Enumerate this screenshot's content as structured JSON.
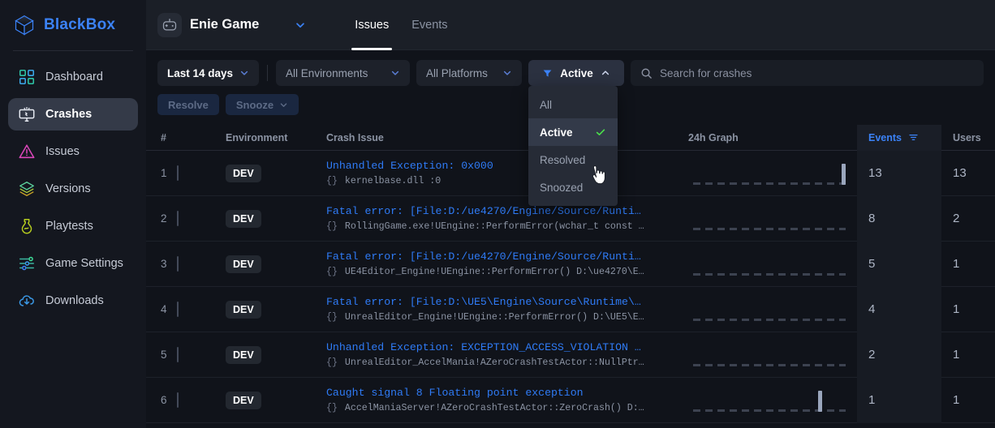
{
  "brand": {
    "name": "BlackBox",
    "logo_icon": "cube-logo-icon"
  },
  "sidebar": {
    "items": [
      {
        "label": "Dashboard",
        "icon": "dashboard-grid-icon",
        "active": false
      },
      {
        "label": "Crashes",
        "icon": "crash-monitor-icon",
        "active": true
      },
      {
        "label": "Issues",
        "icon": "warning-triangle-icon",
        "active": false
      },
      {
        "label": "Versions",
        "icon": "layers-stack-icon",
        "active": false
      },
      {
        "label": "Playtests",
        "icon": "flask-potion-icon",
        "active": false
      },
      {
        "label": "Game Settings",
        "icon": "sliders-icon",
        "active": false
      },
      {
        "label": "Downloads",
        "icon": "cloud-download-icon",
        "active": false
      }
    ]
  },
  "topbar": {
    "game_name": "Enie Game",
    "game_icon": "gamepad-robot-icon",
    "game_switch_icon": "chevron-down-icon",
    "tabs": [
      {
        "label": "Issues",
        "active": true
      },
      {
        "label": "Events",
        "active": false
      }
    ]
  },
  "filters": {
    "date_range": "Last 14 days",
    "environment": "All Environments",
    "platform": "All Platforms",
    "status": "Active",
    "status_filter_icon": "funnel-icon",
    "status_caret_icon": "chevron-up-icon",
    "status_open": true,
    "status_options": [
      {
        "label": "All",
        "selected": false
      },
      {
        "label": "Active",
        "selected": true
      },
      {
        "label": "Resolved",
        "selected": false
      },
      {
        "label": "Snoozed",
        "selected": false
      }
    ],
    "check_icon": "check-icon",
    "cursor_icon": "pointer-hand-cursor-icon"
  },
  "search": {
    "placeholder": "Search for crashes",
    "icon": "search-icon"
  },
  "actions": {
    "resolve": "Resolve",
    "snooze": "Snooze",
    "snooze_caret_icon": "chevron-down-icon"
  },
  "table": {
    "columns": {
      "index": "#",
      "environment": "Environment",
      "issue": "Crash Issue",
      "graph": "24h Graph",
      "events": "Events",
      "users": "Users"
    },
    "events_sort_icon": "sort-filter-icon",
    "rows": [
      {
        "index": "1",
        "environment": "DEV",
        "title": "Unhandled Exception: 0x000",
        "subtitle": "kernelbase.dll :0",
        "events": "13",
        "users": "13",
        "bars": [
          {
            "x": 91,
            "h": 26
          }
        ]
      },
      {
        "index": "2",
        "environment": "DEV",
        "title": "Fatal error: [File:D:/ue4270/Engine/Source/Runti…",
        "subtitle": "RollingGame.exe!UEngine::PerformError(wchar_t const …",
        "events": "8",
        "users": "2",
        "bars": []
      },
      {
        "index": "3",
        "environment": "DEV",
        "title": "Fatal error: [File:D:/ue4270/Engine/Source/Runti…",
        "subtitle": "UE4Editor_Engine!UEngine::PerformError() D:\\ue4270\\E…",
        "events": "5",
        "users": "1",
        "bars": []
      },
      {
        "index": "4",
        "environment": "DEV",
        "title": "Fatal error: [File:D:\\UE5\\Engine\\Source\\Runtime\\…",
        "subtitle": "UnrealEditor_Engine!UEngine::PerformError() D:\\UE5\\E…",
        "events": "4",
        "users": "1",
        "bars": []
      },
      {
        "index": "5",
        "environment": "DEV",
        "title": "Unhandled Exception: EXCEPTION_ACCESS_VIOLATION …",
        "subtitle": "UnrealEditor_AccelMania!AZeroCrashTestActor::NullPtr…",
        "events": "2",
        "users": "1",
        "bars": []
      },
      {
        "index": "6",
        "environment": "DEV",
        "title": "Caught signal 8 Floating point exception",
        "subtitle": "AccelManiaServer!AZeroCrashTestActor::ZeroCrash() D:…",
        "events": "1",
        "users": "1",
        "bars": [
          {
            "x": 77,
            "h": 26
          }
        ]
      }
    ]
  },
  "colors": {
    "accent_blue": "#3b82f6",
    "link_blue": "#2f7bf6",
    "check_green": "#4ade4a",
    "sidebar_bg": "#14171f",
    "page_bg": "#10131a"
  }
}
